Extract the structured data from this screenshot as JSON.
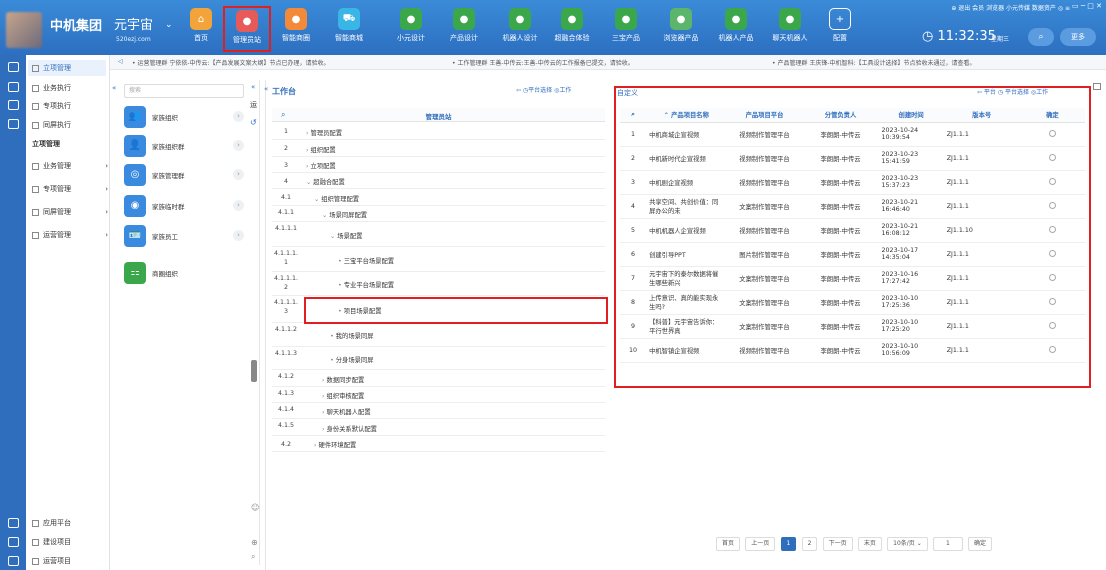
{
  "header": {
    "brand": "中机集团",
    "sub_brand": "元宇宙",
    "site": "520ezj.com",
    "nav": [
      {
        "label": "首页",
        "icon": "home-icon",
        "color": "#f2a33a"
      },
      {
        "label": "管理员站",
        "icon": "admin-icon",
        "color": "#e65a5a"
      },
      {
        "label": "智能商圈",
        "icon": "circle-icon",
        "color": "#f28a3a"
      },
      {
        "label": "智能商城",
        "icon": "cart-icon",
        "color": "#3ab6e6"
      },
      {
        "label": "小元设计",
        "icon": "robot-icon",
        "color": "#3aa84a"
      },
      {
        "label": "产品设计",
        "icon": "robot-icon",
        "color": "#3aa84a"
      },
      {
        "label": "机器人设计",
        "icon": "robot-icon",
        "color": "#3aa84a"
      },
      {
        "label": "超融合体验",
        "icon": "robot-icon",
        "color": "#3aa84a"
      },
      {
        "label": "三宝产品",
        "icon": "robot-icon",
        "color": "#3aa84a"
      },
      {
        "label": "浏览器产品",
        "icon": "browser-icon",
        "color": "#5bb56a"
      },
      {
        "label": "机器人产品",
        "icon": "robot-icon",
        "color": "#3aa84a"
      },
      {
        "label": "聊天机器人",
        "icon": "robot-icon",
        "color": "#3aa84a"
      },
      {
        "label": "配置",
        "icon": "plus-icon",
        "color": "#5a8fd8"
      }
    ],
    "links": "⊕ 退出  会员  浏览器  小元传媒  数据资产  ◎  ≡",
    "window_buttons": "▭  ─  □  ✕",
    "time": "11:32:35",
    "weekday": "星期三",
    "more": "更多",
    "search_icon": "⌕"
  },
  "leftnav": {
    "top": [
      {
        "label": "立项管理",
        "active": true
      },
      {
        "label": "业务执行"
      },
      {
        "label": "专项执行"
      },
      {
        "label": "同屏执行"
      }
    ],
    "section": "立项管理",
    "groups": [
      {
        "label": "业务管理"
      },
      {
        "label": "专项管理"
      },
      {
        "label": "同屏管理"
      },
      {
        "label": "运营管理"
      }
    ],
    "bottom": [
      {
        "label": "应用平台"
      },
      {
        "label": "建设项目"
      },
      {
        "label": "运营项目"
      }
    ]
  },
  "crumbs": [
    "• 运营管理群 宁依依-中传云:【产品发展文案大纲】节点已办理，请验收。",
    "• 工作管理群 王善-中传云:王善-中传云的工作报备已提交，请验收。",
    "• 产品管理群 王庆锋-中机智科:【工具设计选择】节点验收未通过，请查看。"
  ],
  "families": {
    "search_placeholder": "搜索",
    "items": [
      {
        "label": "家族组织",
        "color": "#3a8be0"
      },
      {
        "label": "家族组织群",
        "color": "#3a8be0"
      },
      {
        "label": "家族管理群",
        "color": "#3a8be0"
      },
      {
        "label": "家族临时群",
        "color": "#3a8be0"
      },
      {
        "label": "家族员工",
        "color": "#3a8be0"
      },
      {
        "label": "商圈组织",
        "color": "#3aa84a"
      }
    ]
  },
  "workbench": {
    "title": "工作台",
    "actions": "⇦  ◷平台选择  ◎工作",
    "column": "管理员站",
    "rows": [
      {
        "num": "1",
        "label": "管理员配置",
        "indent": 0,
        "caret": ">"
      },
      {
        "num": "2",
        "label": "组织配置",
        "indent": 0,
        "caret": ">"
      },
      {
        "num": "3",
        "label": "立项配置",
        "indent": 0,
        "caret": ">"
      },
      {
        "num": "4",
        "label": "超融合配置",
        "indent": 0,
        "caret": "v"
      },
      {
        "num": "4.1",
        "label": "组织管理配置",
        "indent": 1,
        "caret": "v"
      },
      {
        "num": "4.1.1",
        "label": "场景同屏配置",
        "indent": 2,
        "caret": "v"
      },
      {
        "num": "4.1.1.1",
        "label": "场景配置",
        "indent": 3,
        "caret": "v"
      },
      {
        "num": "4.1.1.1.1",
        "label": "三宝平台场景配置",
        "indent": 4,
        "caret": "•"
      },
      {
        "num": "4.1.1.1.2",
        "label": "专业平台场景配置",
        "indent": 4,
        "caret": "•"
      },
      {
        "num": "4.1.1.1.3",
        "label": "项目场景配置",
        "indent": 4,
        "caret": "•"
      },
      {
        "num": "4.1.1.2",
        "label": "我的场景同屏",
        "indent": 3,
        "caret": "•"
      },
      {
        "num": "4.1.1.3",
        "label": "分身场景同屏",
        "indent": 3,
        "caret": "•"
      },
      {
        "num": "4.1.2",
        "label": "数据同步配置",
        "indent": 2,
        "caret": ">"
      },
      {
        "num": "4.1.3",
        "label": "组织审核配置",
        "indent": 2,
        "caret": ">"
      },
      {
        "num": "4.1.4",
        "label": "聊天机器人配置",
        "indent": 2,
        "caret": ">"
      },
      {
        "num": "4.1.5",
        "label": "身份关系默认配置",
        "indent": 2,
        "caret": ">"
      },
      {
        "num": "4.2",
        "label": "硬件环境配置",
        "indent": 1,
        "caret": ">"
      }
    ]
  },
  "grid": {
    "title": "自定义",
    "actions": "⇦ 平台  ◷ 平台选择  ◎工作",
    "columns": [
      "产品项目名称",
      "产品项目平台",
      "分管负责人",
      "创建时间",
      "版本号",
      "确定"
    ],
    "rows": [
      [
        "1",
        "中机商城企宣视频",
        "视频制作管理平台",
        "李朗朗-中传云",
        "2023-10-24 10:39:54",
        "ZJ1.1.1"
      ],
      [
        "2",
        "中机新时代企宣视频",
        "视频制作管理平台",
        "李朗朗-中传云",
        "2023-10-23 15:41:59",
        "ZJ1.1.1"
      ],
      [
        "3",
        "中机剧企宣视频",
        "视频制作管理平台",
        "李朗朗-中传云",
        "2023-10-23 15:37:23",
        "ZJ1.1.1"
      ],
      [
        "4",
        "共享空间、共创价值：同屏办公的未",
        "文案制作管理平台",
        "李朗朗-中传云",
        "2023-10-21 16:46:40",
        "ZJ1.1.1"
      ],
      [
        "5",
        "中机机器人企宣视频",
        "视频制作管理平台",
        "李朗朗-中传云",
        "2023-10-21 16:08:12",
        "ZJ1.1.10"
      ],
      [
        "6",
        "创建引导PPT",
        "图片制作管理平台",
        "李朗朗-中传云",
        "2023-10-17 14:35:04",
        "ZJ1.1.1"
      ],
      [
        "7",
        "元宇宙下的泰尔数据将催生哪些新兴",
        "文案制作管理平台",
        "李朗朗-中传云",
        "2023-10-16 17:27:42",
        "ZJ1.1.1"
      ],
      [
        "8",
        "上传意识、真的能实现永生吗?",
        "文案制作管理平台",
        "李朗朗-中传云",
        "2023-10-10 17:25:36",
        "ZJ1.1.1"
      ],
      [
        "9",
        "【科普】元宇宙告诉你：平行世界真",
        "文案制作管理平台",
        "李朗朗-中传云",
        "2023-10-10 17:25:20",
        "ZJ1.1.1"
      ],
      [
        "10",
        "中机智镇企宣视频",
        "视频制作管理平台",
        "李朗朗-中传云",
        "2023-10-10 10:56:09",
        "ZJ1.1.1"
      ]
    ]
  },
  "pager": {
    "first": "首页",
    "prev": "上一页",
    "pages": [
      "1",
      "2"
    ],
    "current": "1",
    "next": "下一页",
    "last": "末页",
    "size": "10条/页",
    "goto": "1",
    "confirm": "确定"
  }
}
